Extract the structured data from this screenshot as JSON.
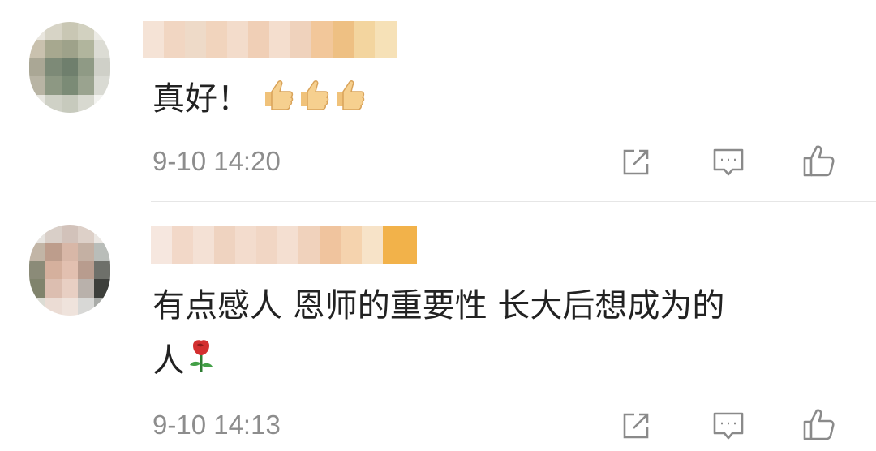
{
  "comments": [
    {
      "text": "真好！",
      "emoji": [
        "thumbs-up-emoji",
        "thumbs-up-emoji",
        "thumbs-up-emoji"
      ],
      "time": "9-10 14:20",
      "actions": [
        "share-icon",
        "reply-icon",
        "like-icon"
      ]
    },
    {
      "text_line1": "有点感人 恩师的重要性 长大后想成为的",
      "text_line2": "人",
      "emoji": [
        "rose-emoji"
      ],
      "time": "9-10 14:13",
      "actions": [
        "share-icon",
        "reply-icon",
        "like-icon"
      ]
    }
  ],
  "colors": {
    "icon": "#8a8a8a",
    "time": "#8d8d8d",
    "text": "#222222",
    "divider": "#e6e6e6"
  }
}
